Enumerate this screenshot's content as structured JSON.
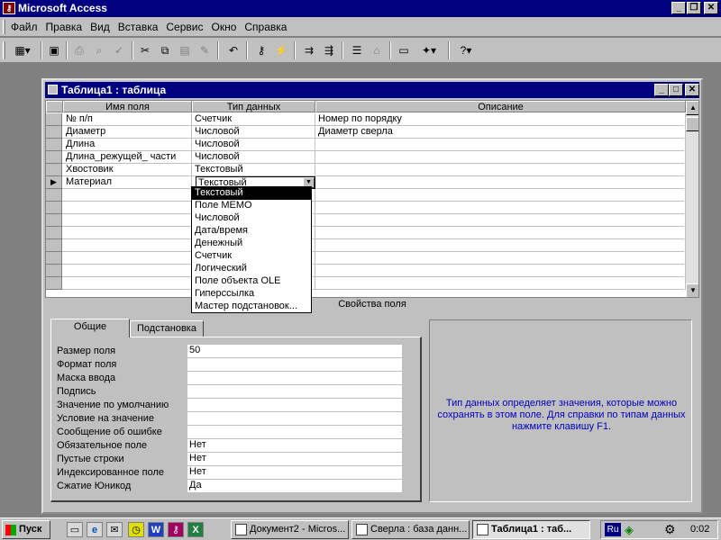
{
  "app": {
    "title": "Microsoft Access"
  },
  "menu": [
    "Файл",
    "Правка",
    "Вид",
    "Вставка",
    "Сервис",
    "Окно",
    "Справка"
  ],
  "toolbar": {
    "icons": [
      "view-icon",
      "save-icon",
      "print-icon",
      "preview-icon",
      "spell-icon",
      "cut-icon",
      "copy-icon",
      "paste-icon",
      "format-painter-icon",
      "undo-icon",
      "key-icon",
      "indexes-icon",
      "insert-row-icon",
      "delete-row-icon",
      "properties-icon",
      "build-icon",
      "database-window-icon",
      "new-object-icon",
      "help-icon"
    ]
  },
  "table_window": {
    "title": "Таблица1 : таблица",
    "columns": [
      "Имя поля",
      "Тип данных",
      "Описание"
    ],
    "rows": [
      {
        "field": "№ п/п",
        "type": "Счетчик",
        "desc": "Номер по порядку"
      },
      {
        "field": "Диаметр",
        "type": "Числовой",
        "desc": "Диаметр сверла"
      },
      {
        "field": "Длина",
        "type": "Числовой",
        "desc": ""
      },
      {
        "field": "Длина_режущей_ части",
        "type": "Числовой",
        "desc": ""
      },
      {
        "field": "Хвостовик",
        "type": "Текстовый",
        "desc": ""
      },
      {
        "field": "Материал",
        "type": "Текстовый",
        "desc": ""
      }
    ],
    "dropdown_options": [
      "Текстовый",
      "Поле MEMO",
      "Числовой",
      "Дата/время",
      "Денежный",
      "Счетчик",
      "Логический",
      "Поле объекта OLE",
      "Гиперссылка",
      "Мастер подстановок..."
    ],
    "dropdown_selected": "Текстовый"
  },
  "properties": {
    "bar_title": "Свойства поля",
    "tabs": [
      "Общие",
      "Подстановка"
    ],
    "active_tab": "Общие",
    "rows": [
      {
        "label": "Размер поля",
        "value": "50"
      },
      {
        "label": "Формат поля",
        "value": ""
      },
      {
        "label": "Маска ввода",
        "value": ""
      },
      {
        "label": "Подпись",
        "value": ""
      },
      {
        "label": "Значение по умолчанию",
        "value": ""
      },
      {
        "label": "Условие на значение",
        "value": ""
      },
      {
        "label": "Сообщение об ошибке",
        "value": ""
      },
      {
        "label": "Обязательное поле",
        "value": "Нет"
      },
      {
        "label": "Пустые строки",
        "value": "Нет"
      },
      {
        "label": "Индексированное поле",
        "value": "Нет"
      },
      {
        "label": "Сжатие Юникод",
        "value": "Да"
      }
    ],
    "help_text": "Тип данных определяет значения, которые можно сохранять в этом поле.  Для справки по типам данных нажмите клавишу F1."
  },
  "taskbar": {
    "start_label": "Пуск",
    "buttons": [
      {
        "label": "Документ2 - Micros...",
        "active": false
      },
      {
        "label": "Сверла : база данн...",
        "active": false
      },
      {
        "label": "Таблица1 : таб...",
        "active": true
      }
    ],
    "lang": "Ru",
    "clock": "0:02"
  }
}
